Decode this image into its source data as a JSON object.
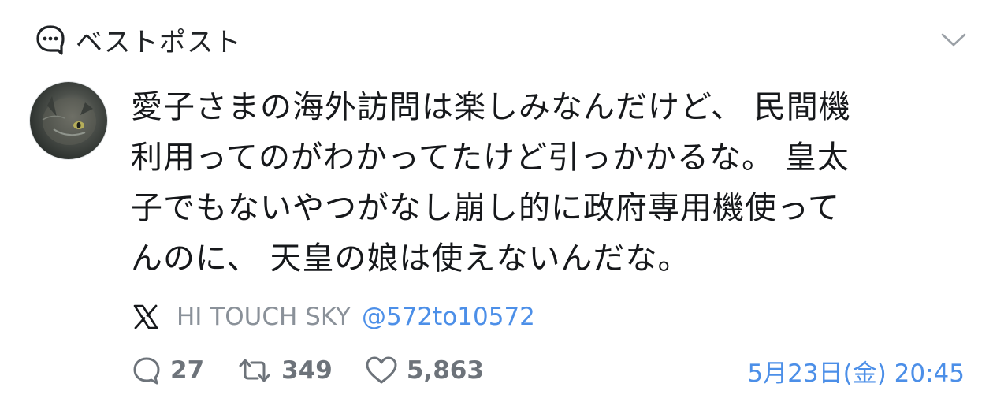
{
  "header": {
    "label": "ベストポスト",
    "icon": "speech-bubble-icon",
    "collapse_icon": "chevron-down-icon"
  },
  "post": {
    "text": "愛子さまの海外訪問は楽しみなんだけど、 民間機\n利用ってのがわかってたけど引っかかるな。 皇太\n子でもないやつがなし崩し的に政府専用機使って\nんのに、 天皇の娘は使えないんだな。",
    "author_name": "HI TOUCH SKY",
    "author_handle": "@572to10572",
    "platform_icon": "x-logo-icon"
  },
  "stats": {
    "replies": "27",
    "reposts": "349",
    "likes": "5,863"
  },
  "timestamp": "5月23日(金) 20:45",
  "colors": {
    "text": "#16181b",
    "muted": "#8a9199",
    "link": "#4c8fe8"
  }
}
